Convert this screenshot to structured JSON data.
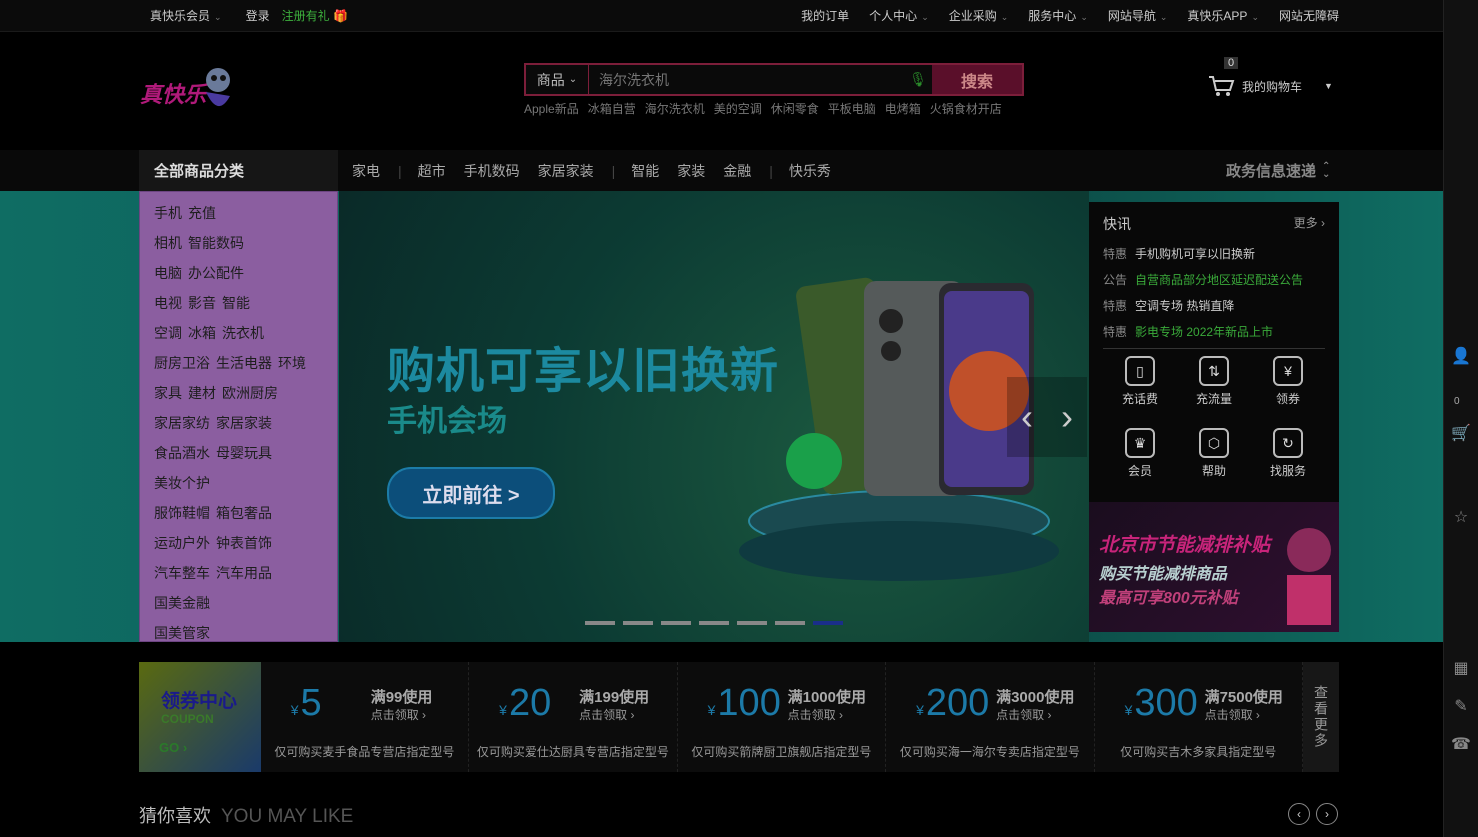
{
  "topbar": {
    "member": "真快乐会员",
    "login": "登录",
    "gift": "注册有礼",
    "right_links": [
      {
        "label": "我的订单",
        "dropdown": false
      },
      {
        "label": "个人中心",
        "dropdown": true
      },
      {
        "label": "企业采购",
        "dropdown": true
      },
      {
        "label": "服务中心",
        "dropdown": true
      },
      {
        "label": "网站导航",
        "dropdown": true
      },
      {
        "label": "真快乐APP",
        "dropdown": true
      },
      {
        "label": "网站无障碍",
        "dropdown": false
      }
    ]
  },
  "search": {
    "category": "商品",
    "placeholder": "海尔洗衣机",
    "button": "搜索",
    "hotwords": [
      "Apple新品",
      "冰箱自营",
      "海尔洗衣机",
      "美的空调",
      "休闲零食",
      "平板电脑",
      "电烤箱",
      "火锅食材开店"
    ]
  },
  "cart": {
    "label": "我的购物车",
    "count": "0"
  },
  "nav": {
    "all_categories": "全部商品分类",
    "items": [
      "家电",
      "超市",
      "手机数码",
      "家居家装",
      "智能",
      "家装",
      "金融",
      "快乐秀"
    ],
    "gov_info": "政务信息速递"
  },
  "category_menu": [
    [
      "手机",
      "充值"
    ],
    [
      "相机",
      "智能数码"
    ],
    [
      "电脑",
      "办公配件"
    ],
    [
      "电视",
      "影音",
      "智能"
    ],
    [
      "空调",
      "冰箱",
      "洗衣机"
    ],
    [
      "厨房卫浴",
      "生活电器",
      "环境"
    ],
    [
      "家具",
      "建材",
      "欧洲厨房"
    ],
    [
      "家居家纺",
      "家居家装"
    ],
    [
      "食品酒水",
      "母婴玩具"
    ],
    [
      "美妆个护"
    ],
    [
      "服饰鞋帽",
      "箱包奢品"
    ],
    [
      "运动户外",
      "钟表首饰"
    ],
    [
      "汽车整车",
      "汽车用品"
    ],
    [
      "国美金融"
    ],
    [
      "国美管家"
    ]
  ],
  "banner": {
    "headline": "购机可享以旧换新",
    "subline": "手机会场",
    "cta": "立即前往 >",
    "slides": 7,
    "active_slide": 7
  },
  "news": {
    "title": "快讯",
    "more": "更多",
    "items": [
      {
        "tag": "特惠",
        "text": "手机购机可享以旧换新",
        "highlight": false
      },
      {
        "tag": "公告",
        "text": "自营商品部分地区延迟配送公告",
        "highlight": true
      },
      {
        "tag": "特惠",
        "text": "空调专场 热销直降",
        "highlight": false
      },
      {
        "tag": "特惠",
        "text": "影电专场 2022年新品上市",
        "highlight": true
      }
    ]
  },
  "services": [
    {
      "label": "充话费",
      "icon": "phone-icon"
    },
    {
      "label": "充流量",
      "icon": "data-icon"
    },
    {
      "label": "领券",
      "icon": "coupon-icon"
    },
    {
      "label": "会员",
      "icon": "crown-icon"
    },
    {
      "label": "帮助",
      "icon": "help-icon"
    },
    {
      "label": "找服务",
      "icon": "service-icon"
    }
  ],
  "subsidy": {
    "line1": "北京市节能减排补贴",
    "line2": "购买节能减排商品",
    "line3": "最高可享800元补贴"
  },
  "coupons": {
    "center_title": "领券中心",
    "center_en": "COUPON",
    "center_go": "GO",
    "items": [
      {
        "amount": "5",
        "rule": "满99使用",
        "click": "点击领取",
        "desc": "仅可购买麦手食品专营店指定型号"
      },
      {
        "amount": "20",
        "rule": "满199使用",
        "click": "点击领取",
        "desc": "仅可购买爱仕达厨具专营店指定型号"
      },
      {
        "amount": "100",
        "rule": "满1000使用",
        "click": "点击领取",
        "desc": "仅可购买箭牌厨卫旗舰店指定型号"
      },
      {
        "amount": "200",
        "rule": "满3000使用",
        "click": "点击领取",
        "desc": "仅可购买海一海尔专卖店指定型号"
      },
      {
        "amount": "300",
        "rule": "满7500使用",
        "click": "点击领取",
        "desc": "仅可购买吉木多家具指定型号"
      }
    ],
    "view_more": "查看更多"
  },
  "guess": {
    "title": "猜你喜欢",
    "subtitle": "YOU MAY LIKE"
  },
  "sidebar": {
    "cart_count": "0"
  }
}
